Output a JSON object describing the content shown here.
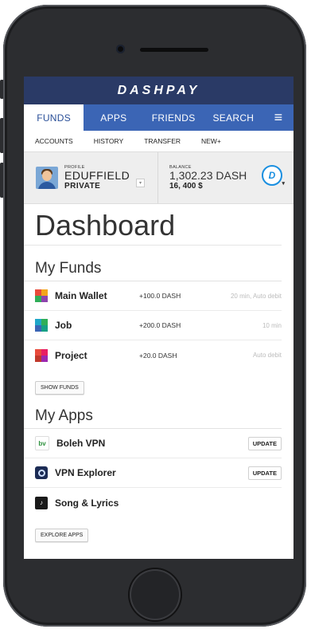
{
  "brand": "DASHPAY",
  "tabs": [
    {
      "label": "FUNDS",
      "active": true
    },
    {
      "label": "APPS",
      "active": false
    },
    {
      "label": "FRIENDS",
      "active": false
    },
    {
      "label": "SEARCH",
      "active": false
    }
  ],
  "menu_icon": "≡",
  "subnav": [
    "ACCOUNTS",
    "HISTORY",
    "TRANSFER",
    "NEW+"
  ],
  "profile": {
    "caption": "PROFILE",
    "name": "EDUFFIELD",
    "visibility": "PRIVATE"
  },
  "balance": {
    "caption": "BALANCE",
    "dash": "1,302.23 DASH",
    "usd": "16, 400 $"
  },
  "page_title": "Dashboard",
  "funds": {
    "heading": "My Funds",
    "items": [
      {
        "name": "Main Wallet",
        "amount": "+100.0 DASH",
        "meta": "20 min, Auto debit"
      },
      {
        "name": "Job",
        "amount": "+200.0 DASH",
        "meta": "10 min"
      },
      {
        "name": "Project",
        "amount": "+20.0 DASH",
        "meta": "Auto debit"
      }
    ],
    "button": "SHOW FUNDS"
  },
  "apps": {
    "heading": "My Apps",
    "items": [
      {
        "name": "Boleh VPN",
        "action": "UPDATE",
        "icon_text": "bv"
      },
      {
        "name": "VPN Explorer",
        "action": "UPDATE",
        "icon_text": ""
      },
      {
        "name": "Song & Lyrics",
        "action": "",
        "icon_text": "♪"
      }
    ],
    "button": "EXPLORE APPS"
  }
}
